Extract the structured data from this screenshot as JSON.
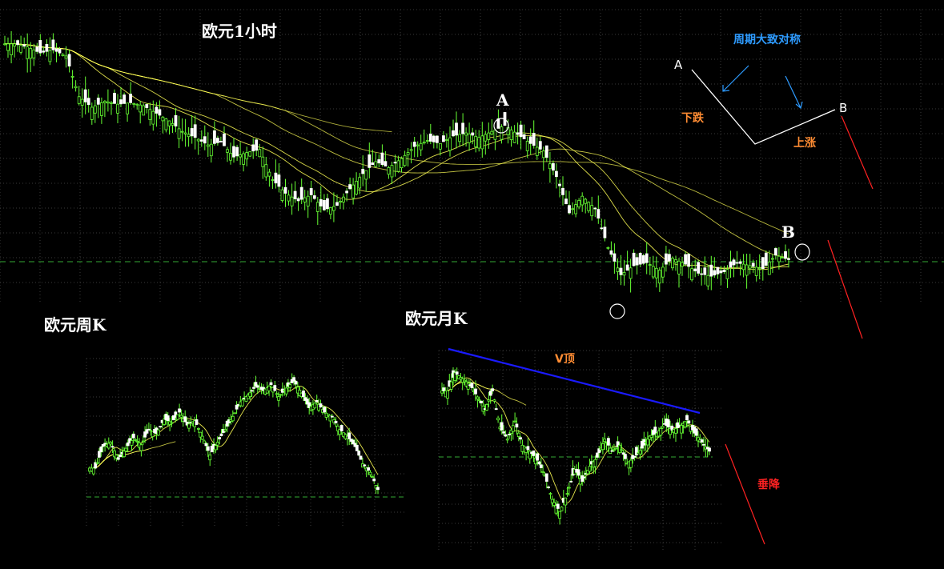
{
  "colors": {
    "background": "#000000",
    "grid": "#3a3a3a",
    "bull": "#66ff33",
    "bear": "#ffffff",
    "ma": "#ffff55",
    "dashed": "#33aa33",
    "trendline": "#1a1aff",
    "red": "#ff2222",
    "blue_text": "#2e9bff",
    "orange_text": "#ff8c33",
    "white": "#ffffff"
  },
  "labels": {
    "hourly_title": "欧元1小时",
    "weekly_title": "欧元周K",
    "monthly_title": "欧元月K",
    "point_a": "A",
    "point_b": "B",
    "diagram_a": "A",
    "diagram_b": "B",
    "symmetry": "周期大致对称",
    "fall": "下跌",
    "rise": "上涨",
    "v_top": "V顶",
    "vertical_drop": "垂降"
  },
  "chart_data": [
    {
      "type": "candlestick",
      "name": "hourly",
      "title": "欧元1小时",
      "grid": true,
      "moving_averages": 8,
      "close": [
        1.349,
        1.3488,
        1.3484,
        1.3486,
        1.3482,
        1.3455,
        1.3448,
        1.3452,
        1.345,
        1.3451,
        1.3449,
        1.3444,
        1.3439,
        1.3432,
        1.3428,
        1.3423,
        1.3425,
        1.3415,
        1.3418,
        1.342,
        1.34,
        1.3391,
        1.3386,
        1.339,
        1.338,
        1.3383,
        1.3394,
        1.3404,
        1.3412,
        1.3408,
        1.3414,
        1.3422,
        1.3426,
        1.3424,
        1.3429,
        1.3431,
        1.3428,
        1.3432,
        1.3436,
        1.343,
        1.3424,
        1.3419,
        1.3402,
        1.3378,
        1.3389,
        1.3381,
        1.3355,
        1.3337,
        1.3343,
        1.3345,
        1.334,
        1.3348,
        1.3344,
        1.3338,
        1.3336,
        1.3339,
        1.3345,
        1.3343,
        1.3341,
        1.335,
        1.3347
      ],
      "reference_level": 1.3352,
      "annotations": [
        "A",
        "B"
      ]
    },
    {
      "type": "candlestick",
      "name": "weekly",
      "title": "欧元周K",
      "grid": true,
      "moving_averages": 6,
      "close": [
        1.295,
        1.32,
        1.325,
        1.305,
        1.318,
        1.33,
        1.322,
        1.34,
        1.335,
        1.352,
        1.348,
        1.36,
        1.345,
        1.35,
        1.332,
        1.31,
        1.325,
        1.34,
        1.355,
        1.372,
        1.38,
        1.39,
        1.385,
        1.392,
        1.378,
        1.388,
        1.396,
        1.382,
        1.365,
        1.372,
        1.36,
        1.355,
        1.34,
        1.332,
        1.32,
        1.3,
        1.29,
        1.27
      ],
      "reference_level": 1.27
    },
    {
      "type": "candlestick",
      "name": "monthly",
      "title": "欧元月K",
      "grid": true,
      "moving_averages": 6,
      "close": [
        1.44,
        1.47,
        1.46,
        1.45,
        1.43,
        1.41,
        1.44,
        1.38,
        1.36,
        1.39,
        1.35,
        1.34,
        1.325,
        1.3,
        1.26,
        1.24,
        1.27,
        1.31,
        1.29,
        1.315,
        1.33,
        1.36,
        1.34,
        1.35,
        1.32,
        1.33,
        1.345,
        1.365,
        1.37,
        1.385,
        1.375,
        1.38,
        1.392,
        1.37,
        1.355,
        1.34
      ],
      "annotations": [
        "V顶",
        "垂降"
      ]
    }
  ]
}
